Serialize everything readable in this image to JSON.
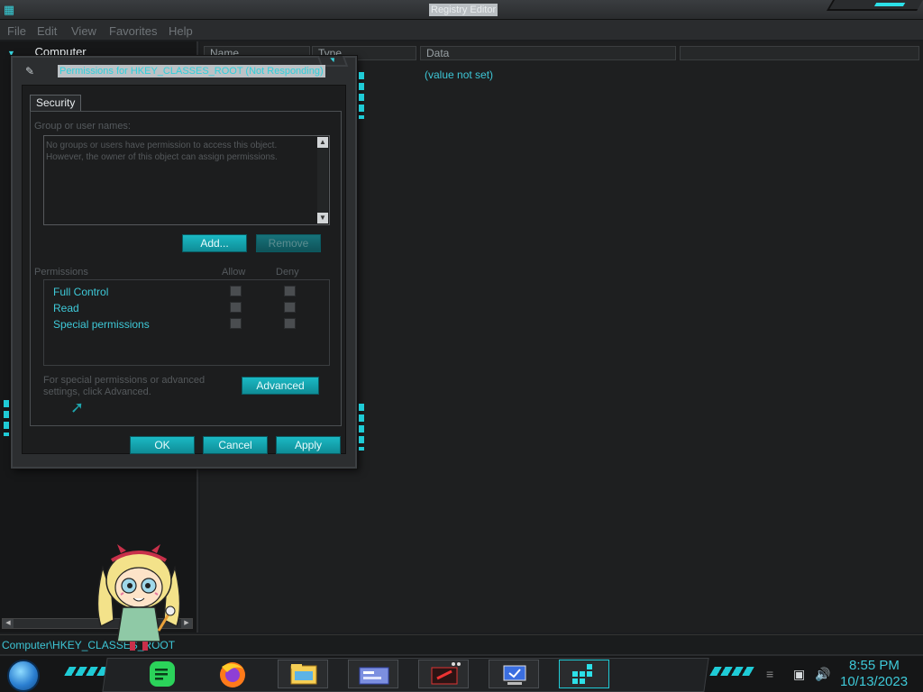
{
  "window": {
    "title": "Registry Editor",
    "menu": [
      "File",
      "Edit",
      "View",
      "Favorites",
      "Help"
    ]
  },
  "tree": {
    "root_label": "Computer"
  },
  "list": {
    "columns": [
      "Name",
      "Type",
      "Data"
    ],
    "value_data": "(value not set)"
  },
  "statusbar": {
    "path": "Computer\\HKEY_CLASSES_ROOT"
  },
  "dialog": {
    "title": "Permissions for HKEY_CLASSES_ROOT (Not Responding)",
    "tab": "Security",
    "group_label": "Group or user names:",
    "users_message": "No groups or users have permission to access this object. However, the owner of this object can assign permissions.",
    "add_label": "Add...",
    "remove_label": "Remove",
    "permissions_label": "Permissions",
    "allow_label": "Allow",
    "deny_label": "Deny",
    "permissions": [
      {
        "name": "Full Control",
        "allow": false,
        "deny": false
      },
      {
        "name": "Read",
        "allow": false,
        "deny": false
      },
      {
        "name": "Special permissions",
        "allow": false,
        "deny": false
      }
    ],
    "advanced_text": "For special permissions or advanced settings, click Advanced.",
    "advanced_label": "Advanced",
    "ok_label": "OK",
    "cancel_label": "Cancel",
    "apply_label": "Apply"
  },
  "taskbar": {
    "time": "8:55 PM",
    "date": "10/13/2023",
    "apps": [
      "messages-app",
      "firefox",
      "file-explorer",
      "control-panel",
      "media-player",
      "remote-desktop",
      "registry-editor"
    ]
  },
  "colors": {
    "accent": "#1fcbd6",
    "button": "#15a8b2",
    "text_accent": "#3ec9d8"
  }
}
